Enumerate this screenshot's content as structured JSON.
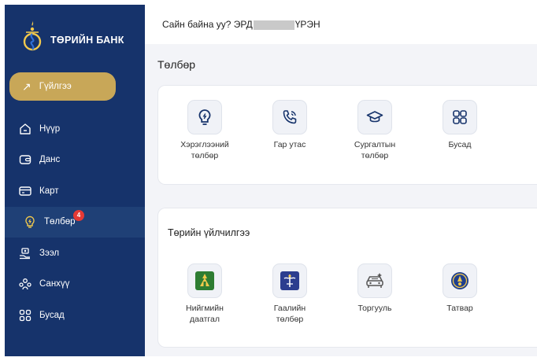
{
  "bank": {
    "name": "ТӨРИЙН БАНК"
  },
  "header": {
    "greeting_prefix": "Сайн байна уу? ЭРД",
    "greeting_suffix": "ҮРЭН"
  },
  "transfer_button": {
    "label": "Гүйлгээ"
  },
  "nav": {
    "home": "Нүүр",
    "account": "Данс",
    "card": "Карт",
    "payment": "Төлбөр",
    "payment_badge": "4",
    "loan": "Зээл",
    "savings": "Санхүү",
    "other": "Бусад"
  },
  "payments": {
    "title": "Төлбөр",
    "tiles": [
      {
        "label": "Хэрэглээний\nтөлбөр",
        "icon": "lightbulb-icon"
      },
      {
        "label": "Гар утас",
        "icon": "phone-icon"
      },
      {
        "label": "Сургалтын\nтөлбөр",
        "icon": "graduation-cap-icon"
      },
      {
        "label": "Бусад",
        "icon": "grid-icon"
      }
    ]
  },
  "gov_services": {
    "title": "Төрийн үйлчилгээ",
    "tiles": [
      {
        "label": "Нийгмийн\nдаатгал",
        "icon": "social-insurance-logo"
      },
      {
        "label": "Гаалийн\nтөлбөр",
        "icon": "customs-logo"
      },
      {
        "label": "Торгууль",
        "icon": "car-fine-icon"
      },
      {
        "label": "Татвар",
        "icon": "tax-logo"
      }
    ]
  },
  "colors": {
    "sidebar": "#16336b",
    "accent_gold": "#c8a758",
    "badge": "#e53935"
  }
}
